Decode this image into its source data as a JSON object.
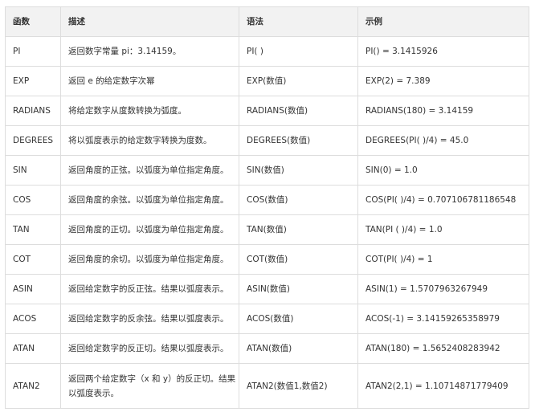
{
  "table": {
    "headers": [
      "函数",
      "描述",
      "语法",
      "示例"
    ],
    "rows": [
      {
        "func": "PI",
        "desc": "返回数字常量 pi：3.14159。",
        "syntax": "PI( )",
        "example": "PI() = 3.1415926"
      },
      {
        "func": "EXP",
        "desc": "返回 e 的给定数字次幂",
        "syntax": "EXP(数值)",
        "example": "EXP(2) = 7.389"
      },
      {
        "func": "RADIANS",
        "desc": "将给定数字从度数转换为弧度。",
        "syntax": "RADIANS(数值)",
        "example": "RADIANS(180) = 3.14159"
      },
      {
        "func": "DEGREES",
        "desc": "将以弧度表示的给定数字转换为度数。",
        "syntax": "DEGREES(数值)",
        "example": "DEGREES(PI( )/4) = 45.0"
      },
      {
        "func": "SIN",
        "desc": "返回角度的正弦。以弧度为单位指定角度。",
        "syntax": "SIN(数值)",
        "example": "SIN(0) = 1.0"
      },
      {
        "func": "COS",
        "desc": "返回角度的余弦。以弧度为单位指定角度。",
        "syntax": "COS(数值)",
        "example": "COS(PI( )/4) = 0.707106781186548"
      },
      {
        "func": "TAN",
        "desc": "返回角度的正切。以弧度为单位指定角度。",
        "syntax": "TAN(数值)",
        "example": "TAN(PI ( )/4) = 1.0"
      },
      {
        "func": "COT",
        "desc": "返回角度的余切。以弧度为单位指定角度。",
        "syntax": "COT(数值)",
        "example": "COT(PI( )/4) = 1"
      },
      {
        "func": "ASIN",
        "desc": "返回给定数字的反正弦。结果以弧度表示。",
        "syntax": "ASIN(数值)",
        "example": "ASIN(1) = 1.5707963267949"
      },
      {
        "func": "ACOS",
        "desc": "返回给定数字的反余弦。结果以弧度表示。",
        "syntax": "ACOS(数值)",
        "example": "ACOS(-1) = 3.14159265358979"
      },
      {
        "func": "ATAN",
        "desc": "返回给定数字的反正切。结果以弧度表示。",
        "syntax": "ATAN(数值)",
        "example": "ATAN(180) = 1.5652408283942"
      },
      {
        "func": "ATAN2",
        "desc": "返回两个给定数字（x 和 y）的反正切。结果以弧度表示。",
        "syntax": "ATAN2(数值1,数值2)",
        "example": "ATAN2(2,1) = 1.10714871779409"
      }
    ]
  }
}
